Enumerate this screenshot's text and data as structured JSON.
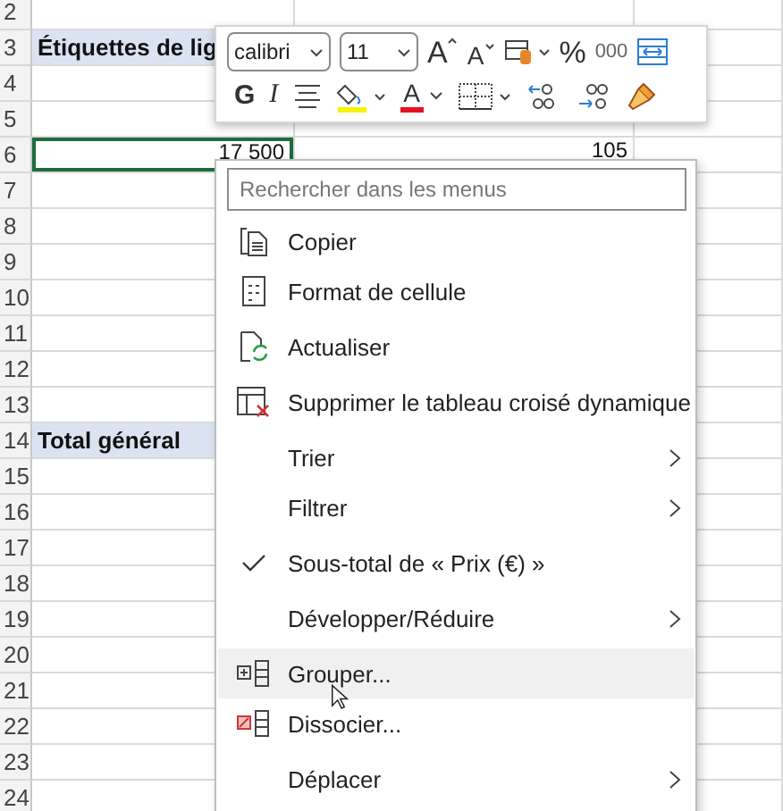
{
  "sheet": {
    "rows": [
      {
        "header": "2"
      },
      {
        "header": "3",
        "cells": [
          {
            "text": "Étiquettes de lig",
            "kind": "row-label",
            "selected": false
          }
        ]
      },
      {
        "header": "4"
      },
      {
        "header": "5"
      },
      {
        "header": "6",
        "cells": [
          {
            "text": "17 500",
            "kind": "value",
            "selected": true
          },
          {
            "text": "105",
            "kind": "value",
            "selected": false
          }
        ]
      },
      {
        "header": "7"
      },
      {
        "header": "8"
      },
      {
        "header": "9"
      },
      {
        "header": "10"
      },
      {
        "header": "11"
      },
      {
        "header": "12"
      },
      {
        "header": "13"
      },
      {
        "header": "14",
        "cells": [
          {
            "text": "Total général",
            "kind": "row-label",
            "selected": false
          }
        ]
      },
      {
        "header": "15"
      },
      {
        "header": "16"
      },
      {
        "header": "17"
      },
      {
        "header": "18"
      },
      {
        "header": "19"
      },
      {
        "header": "20"
      },
      {
        "header": "21"
      },
      {
        "header": "22"
      },
      {
        "header": "23"
      },
      {
        "header": "24"
      }
    ]
  },
  "mini_toolbar": {
    "font": "calibri",
    "size": "11",
    "grow_font": "A",
    "shrink_font": "A",
    "percent": "%",
    "thousands": "000",
    "bold": "G",
    "italic": "I",
    "font_color": "A"
  },
  "context_menu": {
    "search": {
      "placeholder": "Rechercher dans les menus"
    },
    "items": [
      {
        "label": "Copier",
        "kind": "command",
        "separator_before": false,
        "checked": false,
        "selected": false
      },
      {
        "label": "Format de cellule",
        "kind": "command",
        "separator_before": false,
        "checked": false,
        "selected": false
      },
      {
        "label": "Actualiser",
        "kind": "command",
        "separator_before": true,
        "checked": false,
        "selected": false
      },
      {
        "label": "Supprimer le tableau croisé dynamique",
        "kind": "command",
        "separator_before": true,
        "checked": false,
        "selected": false
      },
      {
        "label": "Trier",
        "kind": "submenu",
        "separator_before": true,
        "checked": false,
        "selected": false
      },
      {
        "label": "Filtrer",
        "kind": "submenu",
        "separator_before": false,
        "checked": false,
        "selected": false
      },
      {
        "label": "Sous-total de «  Prix (€)  »",
        "kind": "command",
        "separator_before": true,
        "checked": true,
        "selected": false
      },
      {
        "label": "Développer/Réduire",
        "kind": "submenu",
        "separator_before": true,
        "checked": false,
        "selected": false
      },
      {
        "label": "Grouper...",
        "kind": "command",
        "separator_before": true,
        "checked": false,
        "selected": true
      },
      {
        "label": "Dissocier...",
        "kind": "command",
        "separator_before": false,
        "checked": false,
        "selected": false
      },
      {
        "label": "Déplacer",
        "kind": "submenu",
        "separator_before": true,
        "checked": false,
        "selected": false
      }
    ]
  }
}
